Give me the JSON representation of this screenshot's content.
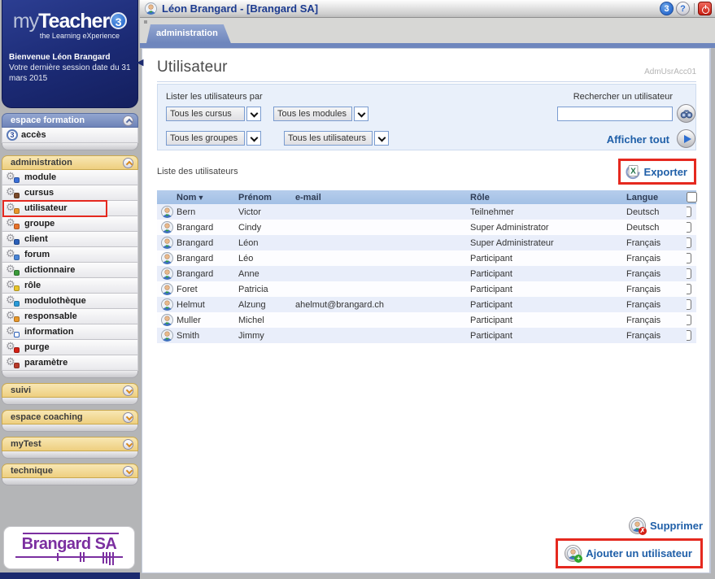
{
  "window": {
    "title": "Léon Brangard - [Brangard SA]",
    "version_badge": "3",
    "help_badge": "?"
  },
  "branding": {
    "logo_my": "my",
    "logo_teacher": "Teacher",
    "logo_version": "3",
    "tagline": "the Learning eXperience",
    "welcome_bold": "Bienvenue Léon Brangard",
    "welcome_text": "Votre dernière session date du 31 mars 2015",
    "company_name": "Brangard SA"
  },
  "sidebar": {
    "formation_header": "espace formation",
    "access_item": {
      "label": "accès",
      "badge": "3"
    },
    "admin_header": "administration",
    "admin_items": [
      {
        "label": "module",
        "icon": "module-icon"
      },
      {
        "label": "cursus",
        "icon": "cursus-icon"
      },
      {
        "label": "utilisateur",
        "icon": "user-admin-icon"
      },
      {
        "label": "groupe",
        "icon": "group-icon"
      },
      {
        "label": "client",
        "icon": "client-icon"
      },
      {
        "label": "forum",
        "icon": "forum-icon"
      },
      {
        "label": "dictionnaire",
        "icon": "dictionary-icon"
      },
      {
        "label": "rôle",
        "icon": "role-key-icon"
      },
      {
        "label": "modulothèque",
        "icon": "library-icon"
      },
      {
        "label": "responsable",
        "icon": "manager-icon"
      },
      {
        "label": "information",
        "icon": "information-icon"
      },
      {
        "label": "purge",
        "icon": "purge-icon"
      },
      {
        "label": "paramètre",
        "icon": "parameter-icon"
      }
    ],
    "collapsed_sections": [
      "suivi",
      "espace coaching",
      "myTest",
      "technique"
    ]
  },
  "tabs": {
    "administration": "administration"
  },
  "page": {
    "title": "Utilisateur",
    "code": "AdmUsrAcc01",
    "filter": {
      "label": "Lister les utilisateurs par",
      "dropdowns": [
        "Tous les cursus",
        "Tous les modules",
        "Tous les groupes",
        "Tous les utilisateurs"
      ],
      "search_label": "Rechercher un utilisateur",
      "search_value": "",
      "show_all": "Afficher tout"
    },
    "list_label": "Liste des utilisateurs",
    "export_label": "Exporter",
    "table": {
      "sort_indicator": "▼",
      "headers": {
        "nom": "Nom",
        "prenom": "Prénom",
        "email": "e-mail",
        "role": "Rôle",
        "langue": "Langue"
      },
      "rows": [
        {
          "nom": "Bern",
          "prenom": "Victor",
          "email": "",
          "role": "Teilnehmer",
          "langue": "Deutsch"
        },
        {
          "nom": "Brangard",
          "prenom": "Cindy",
          "email": "",
          "role": "Super Administrator",
          "langue": "Deutsch"
        },
        {
          "nom": "Brangard",
          "prenom": "Léon",
          "email": "",
          "role": "Super Administrateur",
          "langue": "Français"
        },
        {
          "nom": "Brangard",
          "prenom": "Léo",
          "email": "",
          "role": "Participant",
          "langue": "Français"
        },
        {
          "nom": "Brangard",
          "prenom": "Anne",
          "email": "",
          "role": "Participant",
          "langue": "Français"
        },
        {
          "nom": "Foret",
          "prenom": "Patricia",
          "email": "",
          "role": "Participant",
          "langue": "Français"
        },
        {
          "nom": "Helmut",
          "prenom": "Alzung",
          "email": "ahelmut@brangard.ch",
          "role": "Participant",
          "langue": "Français"
        },
        {
          "nom": "Muller",
          "prenom": "Michel",
          "email": "",
          "role": "Participant",
          "langue": "Français"
        },
        {
          "nom": "Smith",
          "prenom": "Jimmy",
          "email": "",
          "role": "Participant",
          "langue": "Français"
        }
      ]
    },
    "actions": {
      "delete": "Supprimer",
      "add": "Ajouter un utilisateur"
    }
  },
  "colors": {
    "navy": "#1b2a6e",
    "section_blue": "#6d83b8",
    "section_tan": "#eecf7f",
    "table_header_blue": "#a9c6e8",
    "link_blue": "#1f5fa8",
    "annotation_red": "#e5291f",
    "filter_bg": "#e9f0fa"
  }
}
